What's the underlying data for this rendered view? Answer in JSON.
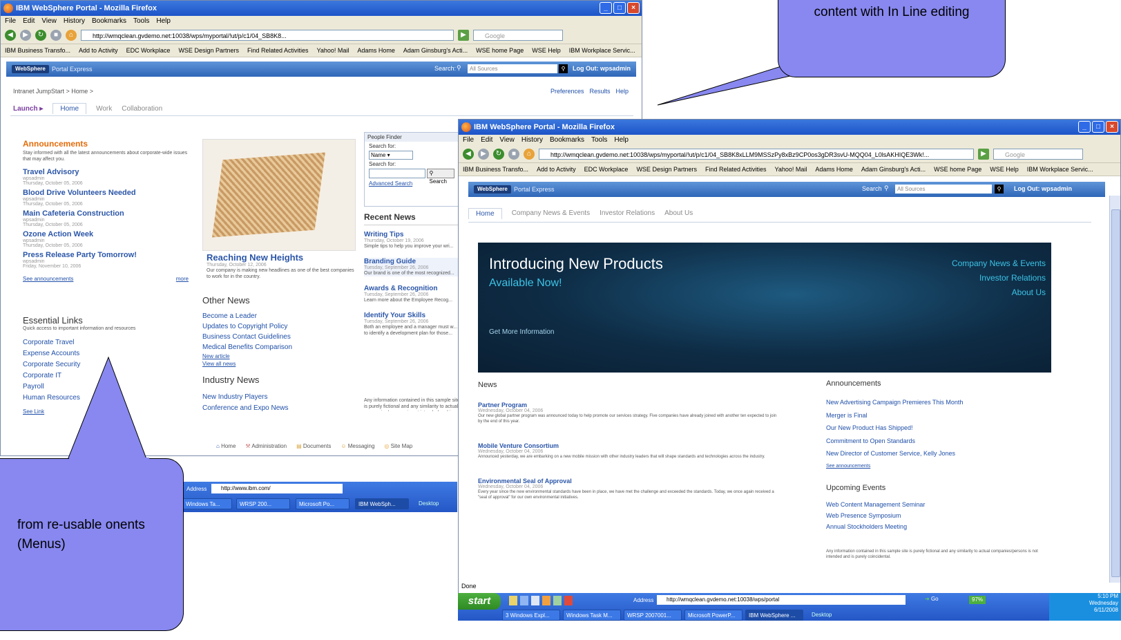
{
  "back_window": {
    "title": "IBM WebSphere Portal - Mozilla Firefox",
    "menu": [
      "File",
      "Edit",
      "View",
      "History",
      "Bookmarks",
      "Tools",
      "Help"
    ],
    "url": "http://wmqclean.gvdemo.net:10038/wps/myportal/!ut/p/c1/04_SB8K8...",
    "search_placeholder": "Google",
    "bookmarks": [
      "IBM Business Transfo...",
      "Add to Activity",
      "EDC Workplace",
      "WSE Design Partners",
      "Find Related Activities",
      "Yahoo! Mail",
      "Adams Home",
      "Adam Ginsburg's Acti...",
      "WSE home Page",
      "WSE Help",
      "IBM Workplace Servic..."
    ],
    "portal": {
      "logo": "WebSphere",
      "name": "Portal Express",
      "search_label": "Search:",
      "search_scope": "All Sources",
      "logout": "Log Out: wpsadmin"
    },
    "breadcrumb": "Intranet JumpStart > Home >",
    "toplinks": [
      "Preferences",
      "Results",
      "Help"
    ],
    "launch": "Launch",
    "tabs": [
      "Home",
      "Work",
      "Collaboration"
    ],
    "announcements": {
      "title": "Announcements",
      "desc": "Stay informed with all the latest announcements about corporate-wide issues that may affect you.",
      "items": [
        {
          "title": "Travel Advisory",
          "author": "wpsadmin",
          "date": "Thursday, October 05, 2006"
        },
        {
          "title": "Blood Drive Volunteers Needed",
          "author": "wpsadmin",
          "date": "Thursday, October 05, 2006"
        },
        {
          "title": "Main Cafeteria Construction",
          "author": "wpsadmin",
          "date": "Thursday, October 05, 2006"
        },
        {
          "title": "Ozone Action Week",
          "author": "wpsadmin",
          "date": "Thursday, October 05, 2006"
        },
        {
          "title": "Press Release Party Tomorrow!",
          "author": "wpsadmin",
          "date": "Friday, November 10, 2006"
        }
      ],
      "see_all": "See announcements",
      "more": "more"
    },
    "essential_links": {
      "title": "Essential Links",
      "desc": "Quick access to important information and resources",
      "items": [
        "Corporate Travel",
        "Expense Accounts",
        "Corporate Security",
        "Corporate IT",
        "Payroll",
        "Human Resources"
      ],
      "more": "See Link"
    },
    "feature": {
      "title": "Reaching New Heights",
      "date": "Thursday, October 12, 2006",
      "text": "Our company is making new headlines as one of the best companies to work for in the country."
    },
    "other_news": {
      "title": "Other News",
      "items": [
        "Become a Leader",
        "Updates to Copyright Policy",
        "Business Contact Guidelines",
        "Medical Benefits Comparison"
      ],
      "new_article": "New article",
      "view_all": "View all news"
    },
    "industry_news": {
      "title": "Industry News",
      "items": [
        "New Industry Players",
        "Conference and Expo News"
      ]
    },
    "people_finder": {
      "title": "People Finder",
      "search_for_label": "Search for:",
      "search_for_value": "Name",
      "search_label": "Search for:",
      "search_button": "Search",
      "advanced": "Advanced Search"
    },
    "recent_news": {
      "title": "Recent News",
      "items": [
        {
          "title": "Writing Tips",
          "date": "Thursday, October 19, 2006",
          "text": "Simple tips to help you improve your wri..."
        },
        {
          "title": "Branding Guide",
          "date": "Tuesday, September 26, 2006",
          "text": "Our brand is one of the most recognized..."
        },
        {
          "title": "Awards & Recognition",
          "date": "Tuesday, September 26, 2006",
          "text": "Learn more about the Employee Recog..."
        },
        {
          "title": "Identify Your Skills",
          "date": "Tuesday, September 26, 2006",
          "text": "Both an employee and a manager must w... to identify a development plan for those..."
        }
      ]
    },
    "disclaimer": "Any information contained in this sample site is purely fictional and any similarity to actual companies/persons is not intended and is purely coincidental.",
    "footer_links": [
      "Home",
      "Administration",
      "Documents",
      "Messaging",
      "Site Map"
    ],
    "address_label": "Address",
    "address_value": "http://www.ibm.com/",
    "taskbar_items": [
      "Windows Ta...",
      "WRSP 200...",
      "Microsoft Po...",
      "IBM WebSph..."
    ],
    "desktop_label": "Desktop"
  },
  "front_window": {
    "title": "IBM WebSphere Portal - Mozilla Firefox",
    "menu": [
      "File",
      "Edit",
      "View",
      "History",
      "Bookmarks",
      "Tools",
      "Help"
    ],
    "url": "http://wmqclean.gvdemo.net:10038/wps/myportal/!ut/p/c1/04_SB8K8xLLM9MSSzPy8xBz9CP0os3gDR3svU-MQQ04_L0lsAKHIQE3Wk!...",
    "search_placeholder": "Google",
    "bookmarks": [
      "IBM Business Transfo...",
      "Add to Activity",
      "EDC Workplace",
      "WSE Design Partners",
      "Find Related Activities",
      "Yahoo! Mail",
      "Adams Home",
      "Adam Ginsburg's Acti...",
      "WSE home Page",
      "WSE Help",
      "IBM Workplace Servic..."
    ],
    "portal": {
      "logo": "WebSphere",
      "name": "Portal Express",
      "search_label": "Search",
      "search_scope": "All Sources",
      "logout": "Log Out: wpsadmin"
    },
    "tabs": [
      "Home",
      "Company News & Events",
      "Investor Relations",
      "About Us"
    ],
    "banner": {
      "title": "Introducing New Products",
      "subtitle": "Available Now!",
      "cta": "Get More Information",
      "links": [
        "Company News & Events",
        "Investor Relations",
        "About Us"
      ]
    },
    "news": {
      "title": "News",
      "items": [
        {
          "title": "Partner Program",
          "date": "Wednesday, October 04, 2006",
          "text": "Our new global partner program was announced today to help promote our services strategy. Five companies have already joined with another ten expected to join by the end of this year."
        },
        {
          "title": "Mobile Venture Consortium",
          "date": "Wednesday, October 04, 2006",
          "text": "Announced yesterday, we are embarking on a new mobile mission with other industry leaders that will shape standards and technologies across the industry."
        },
        {
          "title": "Environmental Seal of Approval",
          "date": "Wednesday, October 04, 2006",
          "text": "Every year since the new environmental standards have been in place, we have met the challenge and exceeded the standards. Today, we once again received a \"seal of approval\" for our own environmental initiatives."
        }
      ]
    },
    "announcements": {
      "title": "Announcements",
      "items": [
        "New Advertising Campaign Premieres This Month",
        "Merger is Final",
        "Our New Product Has Shipped!",
        "Commitment to Open Standards",
        "New Director of Customer Service, Kelly Jones"
      ],
      "see_all": "See announcements"
    },
    "events": {
      "title": "Upcoming Events",
      "items": [
        "Web Content Management Seminar",
        "Web Presence Symposium",
        "Annual Stockholders Meeting"
      ]
    },
    "disclaimer": "Any information contained in this sample site is purely fictional and any similarity to actual companies/persons is not intended and is purely coincidental.",
    "status": "Done",
    "taskbar": {
      "start": "start",
      "address_label": "Address",
      "address_value": "http://wmqclean.gvdemo.net:10038/wps/portal",
      "go": "Go",
      "zoom": "97%",
      "clock_time": "5:10 PM",
      "clock_day": "Wednesday",
      "clock_date": "6/11/2008",
      "items": [
        "3 Windows Expl...",
        "Windows Task M...",
        "WRSP 2007001...",
        "Microsoft PowerP...",
        "IBM WebSphere ..."
      ],
      "desktop_label": "Desktop"
    }
  },
  "callouts": {
    "top": "content with In Line editing",
    "bottom": "from re-usable onents (Menus)"
  },
  "colors": {
    "bubble": "#8888f0",
    "portal_bar": "#3f75c4",
    "banner": "#0e2c45",
    "link": "#1f4fa8",
    "announcement_orange": "#e36c0a"
  }
}
